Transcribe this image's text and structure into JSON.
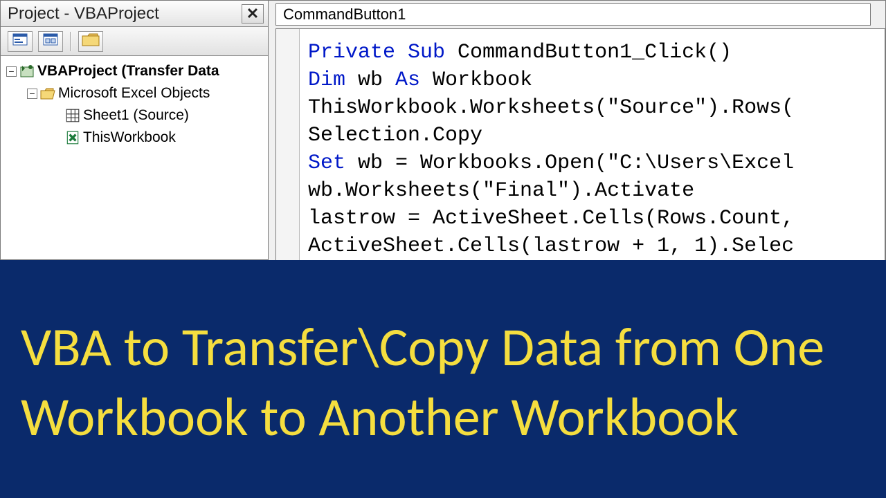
{
  "project_pane": {
    "title": "Project - VBAProject",
    "close_glyph": "✕",
    "tree": {
      "root": "VBAProject (Transfer Data",
      "folder": "Microsoft Excel Objects",
      "sheet": "Sheet1 (Source)",
      "thiswb": "ThisWorkbook"
    }
  },
  "code_pane": {
    "object_selected": "CommandButton1",
    "code_lines": [
      [
        [
          "kw",
          "Private Sub"
        ],
        [
          "",
          " CommandButton1_Click()"
        ]
      ],
      [
        [
          "kw",
          "Dim"
        ],
        [
          "",
          " wb "
        ],
        [
          "kw",
          "As"
        ],
        [
          "",
          " Workbook"
        ]
      ],
      [
        [
          "",
          "ThisWorkbook.Worksheets(\"Source\").Rows("
        ]
      ],
      [
        [
          "",
          "Selection.Copy"
        ]
      ],
      [
        [
          "kw",
          "Set"
        ],
        [
          "",
          " wb = Workbooks.Open(\"C:\\Users\\Excel"
        ]
      ],
      [
        [
          "",
          "wb.Worksheets(\"Final\").Activate"
        ]
      ],
      [
        [
          "",
          "lastrow = ActiveSheet.Cells(Rows.Count,"
        ]
      ],
      [
        [
          "",
          "ActiveSheet.Cells(lastrow + 1, 1).Selec"
        ]
      ]
    ]
  },
  "banner": {
    "text": "VBA to Transfer\\Copy Data from One Workbook to Another Workbook"
  }
}
